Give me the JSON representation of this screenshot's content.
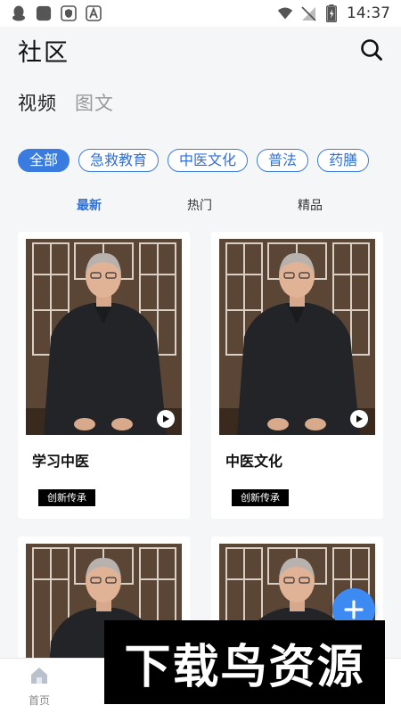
{
  "status_bar": {
    "time": "14:37"
  },
  "header": {
    "title": "社区"
  },
  "top_tabs": [
    {
      "label": "视频",
      "active": true
    },
    {
      "label": "图文",
      "active": false
    }
  ],
  "categories": [
    {
      "label": "全部",
      "active": true
    },
    {
      "label": "急救教育",
      "active": false
    },
    {
      "label": "中医文化",
      "active": false
    },
    {
      "label": "普法",
      "active": false
    },
    {
      "label": "药膳",
      "active": false
    }
  ],
  "sort_tabs": [
    {
      "label": "最新",
      "active": true
    },
    {
      "label": "热门",
      "active": false
    },
    {
      "label": "精品",
      "active": false
    }
  ],
  "cards": [
    {
      "title": "学习中医",
      "tag": "创新传承"
    },
    {
      "title": "中医文化",
      "tag": "创新传承"
    },
    {
      "title": "",
      "tag": ""
    },
    {
      "title": "",
      "tag": ""
    }
  ],
  "bottom_nav": [
    {
      "label": "首页",
      "icon": "home-icon"
    }
  ],
  "watermark": {
    "text": "下载鸟资源"
  },
  "colors": {
    "accent": "#3a7be0",
    "fab": "#3d8bf2",
    "background": "#f5f6f8"
  }
}
